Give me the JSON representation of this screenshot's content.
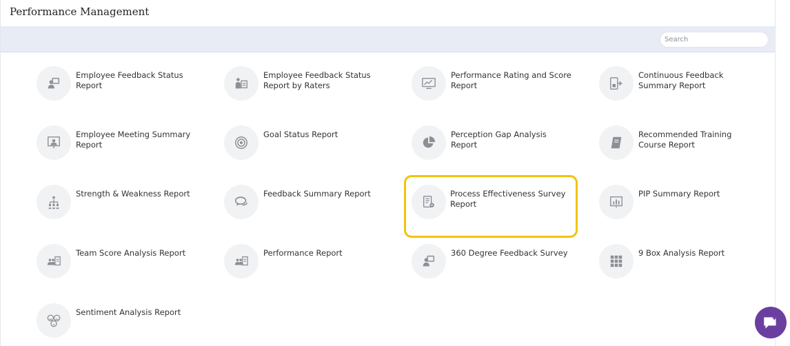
{
  "header": {
    "title": "Performance Management"
  },
  "search": {
    "placeholder": "Search"
  },
  "reports": [
    {
      "label": "Employee Feedback Status Report",
      "icon": "employee-feedback-icon"
    },
    {
      "label": "Employee Feedback Status Report by Raters",
      "icon": "raters-icon"
    },
    {
      "label": "Performance Rating and Score Report",
      "icon": "monitor-chart-icon"
    },
    {
      "label": "Continuous Feedback Summary Report",
      "icon": "continuous-feedback-icon"
    },
    {
      "label": "Employee Meeting Summary Report",
      "icon": "meeting-board-icon"
    },
    {
      "label": "Goal Status Report",
      "icon": "target-icon"
    },
    {
      "label": "Perception Gap Analysis Report",
      "icon": "pie-chart-icon"
    },
    {
      "label": "Recommended Training Course Report",
      "icon": "book-icon"
    },
    {
      "label": "Strength & Weakness Report",
      "icon": "hierarchy-icon"
    },
    {
      "label": "Feedback Summary Report",
      "icon": "chat-bubbles-icon"
    },
    {
      "label": "Process Effectiveness Survey Report",
      "icon": "document-gear-icon"
    },
    {
      "label": "PIP Summary Report",
      "icon": "presentation-chart-icon"
    },
    {
      "label": "Team Score Analysis Report",
      "icon": "team-report-icon"
    },
    {
      "label": "Performance Report",
      "icon": "team-performance-icon"
    },
    {
      "label": "360 Degree Feedback Survey",
      "icon": "survey-person-icon"
    },
    {
      "label": "9 Box Analysis Report",
      "icon": "nine-box-icon"
    },
    {
      "label": "Sentiment Analysis Report",
      "icon": "faces-icon"
    }
  ],
  "highlighted_report": "Process Effectiveness Survey Report",
  "colors": {
    "toolbar": "#e8ecf5",
    "icon_bg": "#f1f2f4",
    "icon_fg": "#8c8f96",
    "highlight": "#f4c20d",
    "chat_button": "#6b3fa0"
  },
  "chat_button": {
    "icon": "chat-support-icon"
  }
}
